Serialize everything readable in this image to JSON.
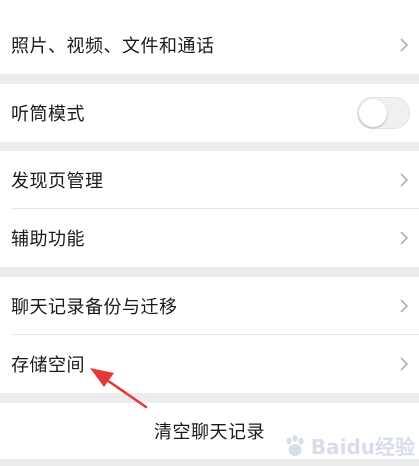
{
  "settings": {
    "media_label": "照片、视频、文件和通话",
    "earpiece_label": "听筒模式",
    "earpiece_enabled": false,
    "discover_label": "发现页管理",
    "accessibility_label": "辅助功能",
    "backup_label": "聊天记录备份与迁移",
    "storage_label": "存储空间",
    "clear_label": "清空聊天记录"
  },
  "watermark": {
    "text": "Baidu经验"
  },
  "colors": {
    "background": "#ededed",
    "row": "#ffffff",
    "arrow": "#e53935"
  }
}
